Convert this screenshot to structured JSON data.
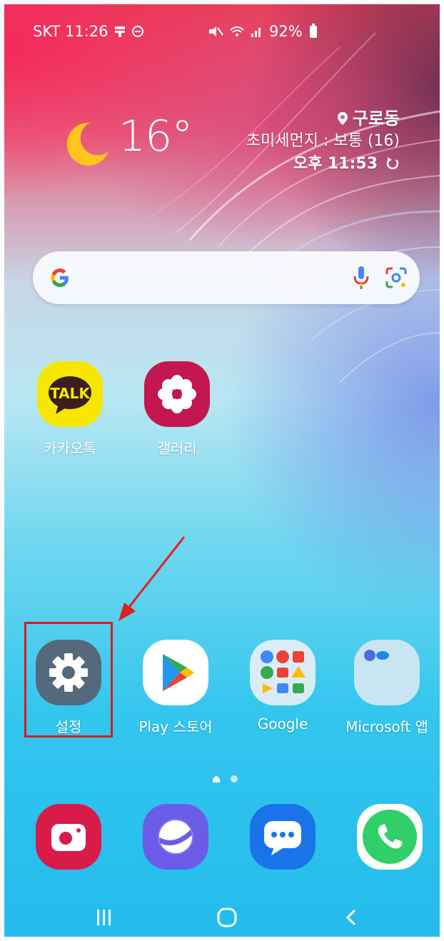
{
  "status_bar": {
    "carrier_time": "SKT 11:26",
    "icons_left": [
      "message-icon",
      "dnd-icon"
    ],
    "icons_right": [
      "mute-icon",
      "wifi-icon",
      "signal-icon"
    ],
    "battery": "92%"
  },
  "weather": {
    "temperature": "16°",
    "location": "구로동",
    "air_quality": "초미세먼지 : 보통 (16)",
    "updated": "오후 11:53",
    "icon": "moon-icon"
  },
  "search_bar": {
    "icons": [
      "google-g-icon",
      "mic-icon",
      "lens-icon"
    ]
  },
  "apps_top": [
    {
      "label": "카카오톡",
      "icon_text": "TALK"
    },
    {
      "label": "갤러리"
    }
  ],
  "apps_row": [
    {
      "label": "설정"
    },
    {
      "label": "Play 스토어"
    },
    {
      "label": "Google"
    },
    {
      "label": "Microsoft 앱"
    }
  ],
  "dock": [
    {
      "name": "camera"
    },
    {
      "name": "internet"
    },
    {
      "name": "messages"
    },
    {
      "name": "phone"
    }
  ],
  "page_indicator": {
    "pages": 2,
    "current": 1
  },
  "colors": {
    "highlight": "#d81c1c",
    "kakao": "#f7e600",
    "gallery": "#c2184f",
    "settings": "#55697d",
    "camera": "#d81b47",
    "internet": "#6b5ce7",
    "messages": "#1a73e8",
    "phone": "#2fd06a"
  }
}
